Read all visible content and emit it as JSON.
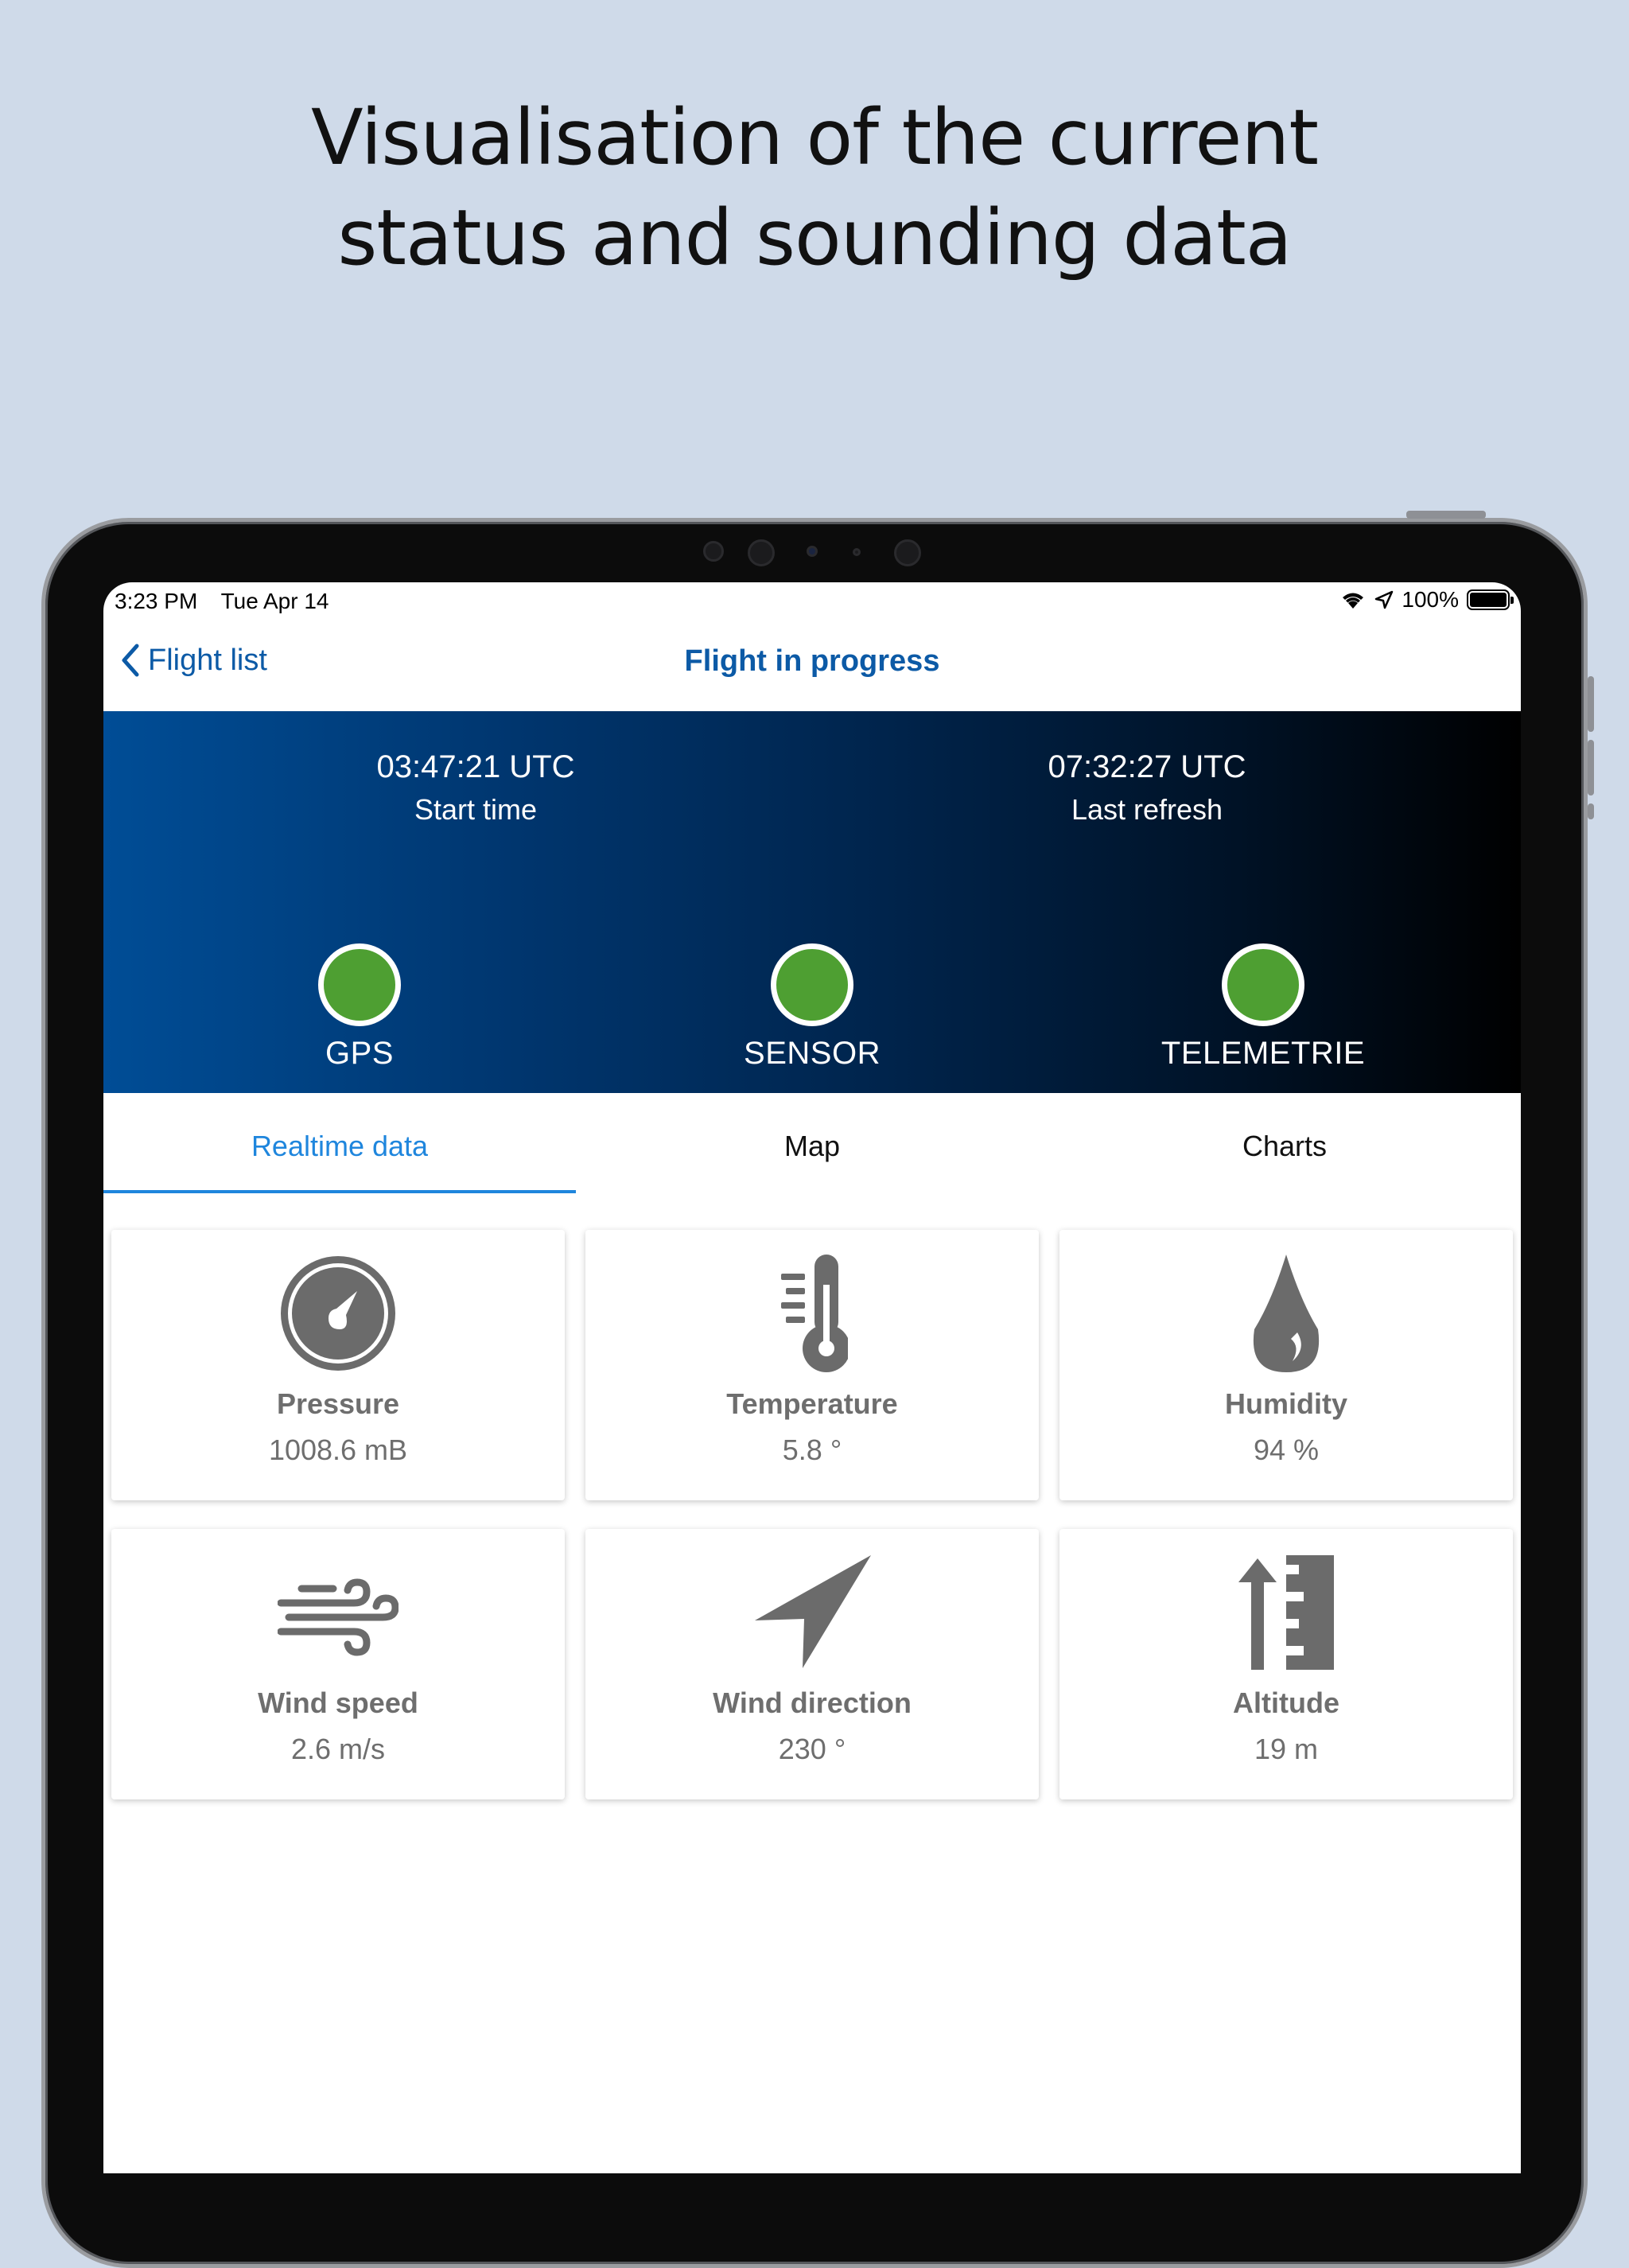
{
  "headline": {
    "line1": "Visualisation of the current",
    "line2": "status and sounding data"
  },
  "status_bar": {
    "time": "3:23 PM",
    "date": "Tue Apr 14",
    "battery": "100%"
  },
  "nav": {
    "back_label": "Flight list",
    "title": "Flight in progress"
  },
  "banner": {
    "start_time": "03:47:21 UTC",
    "start_label": "Start time",
    "refresh_time": "07:32:27 UTC",
    "refresh_label": "Last refresh",
    "indicators": [
      {
        "label": "GPS",
        "status_color": "#4e9f32"
      },
      {
        "label": "SENSOR",
        "status_color": "#4e9f32"
      },
      {
        "label": "TELEMETRIE",
        "status_color": "#4e9f32"
      }
    ]
  },
  "tabs": [
    {
      "label": "Realtime data",
      "active": true
    },
    {
      "label": "Map",
      "active": false
    },
    {
      "label": "Charts",
      "active": false
    }
  ],
  "cards": [
    {
      "icon": "gauge-icon",
      "title": "Pressure",
      "value": "1008.6 mB"
    },
    {
      "icon": "thermometer-icon",
      "title": "Temperature",
      "value": "5.8 °"
    },
    {
      "icon": "droplet-icon",
      "title": "Humidity",
      "value": "94 %"
    },
    {
      "icon": "wind-icon",
      "title": "Wind speed",
      "value": "2.6 m/s"
    },
    {
      "icon": "navigation-arrow-icon",
      "title": "Wind direction",
      "value": "230 °"
    },
    {
      "icon": "altitude-icon",
      "title": "Altitude",
      "value": "19 m"
    }
  ],
  "colors": {
    "accent": "#0c5aa6",
    "tab_active": "#1f86dd",
    "status_ok": "#4e9f32",
    "background": "#cfdae9"
  }
}
